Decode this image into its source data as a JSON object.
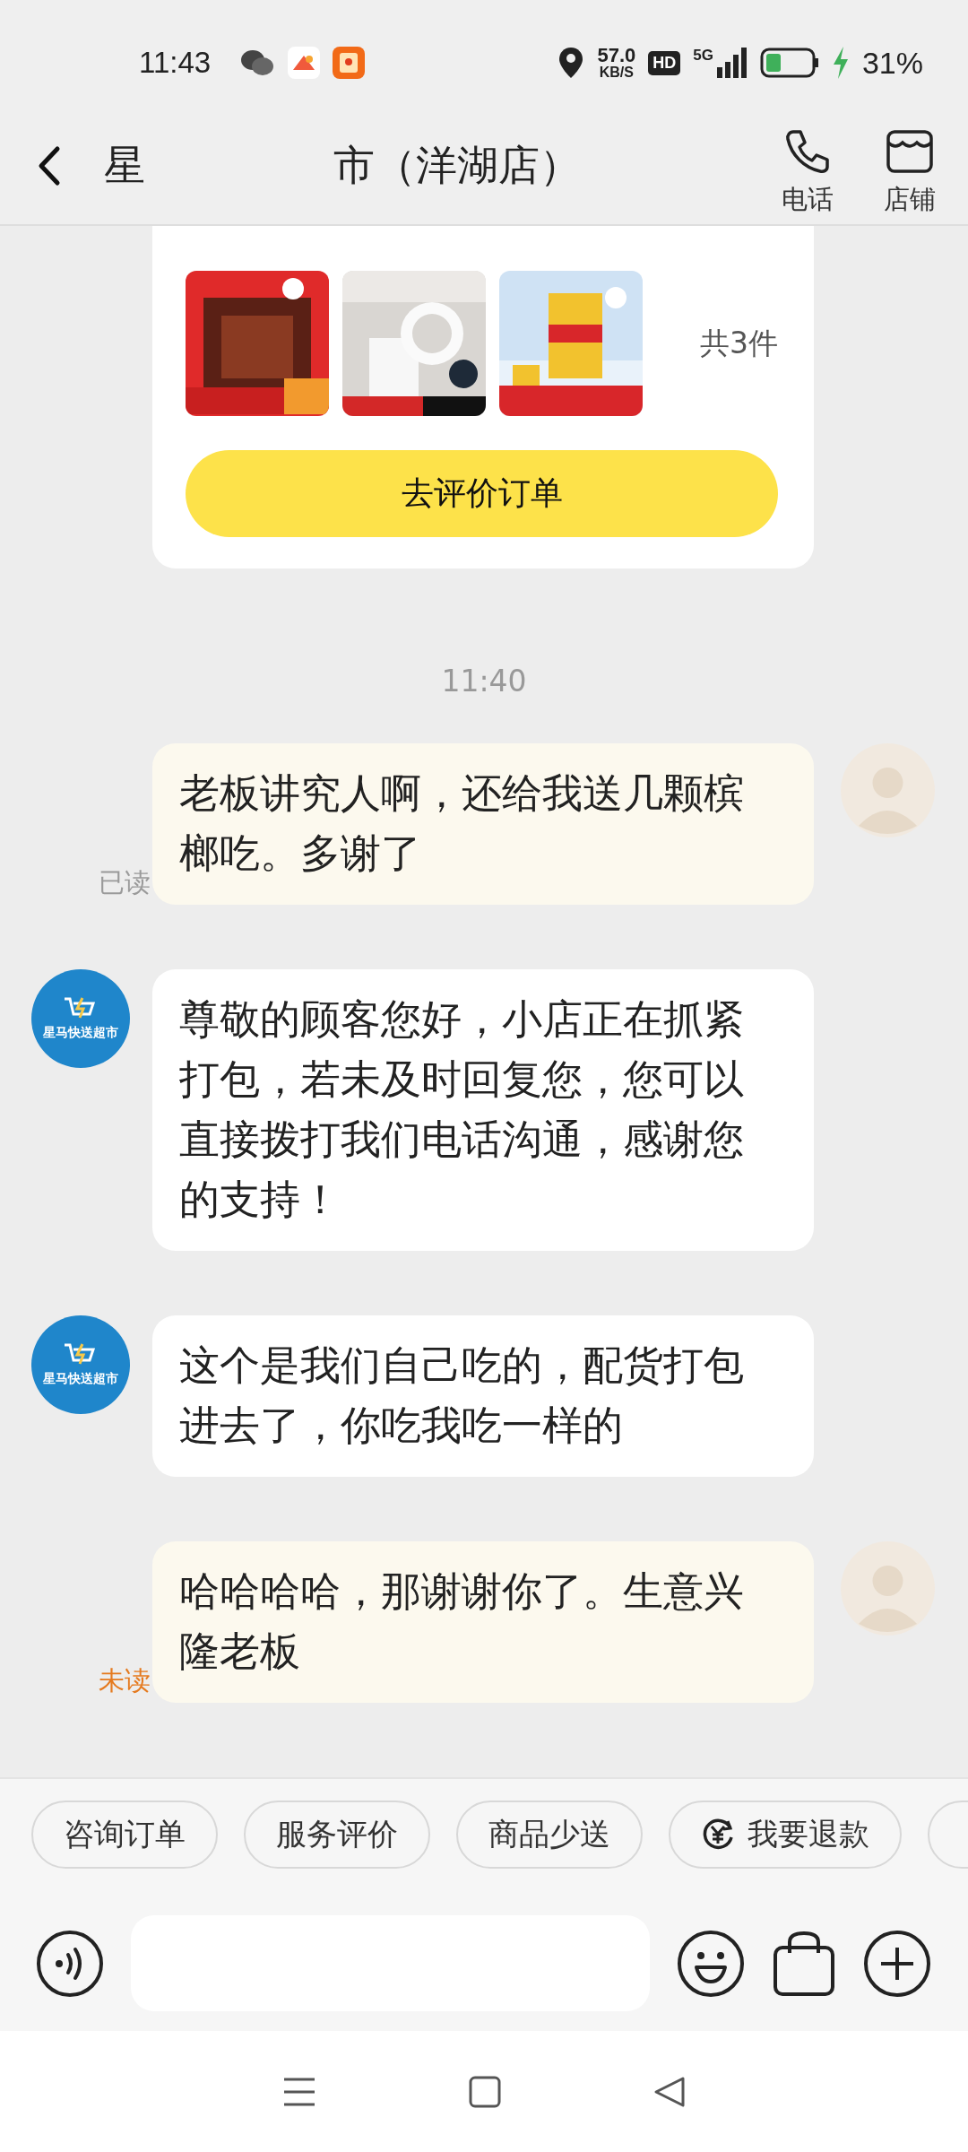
{
  "status_bar": {
    "time": "11:43",
    "speed_value": "57.0",
    "speed_unit": "KB/S",
    "hd": "HD",
    "network": "5G",
    "battery": "31%"
  },
  "header": {
    "title_start": "星",
    "title_end": "市（洋湖店）",
    "actions": [
      {
        "kind": "phone",
        "label": "电话"
      },
      {
        "kind": "store",
        "label": "店铺"
      }
    ]
  },
  "order_card": {
    "count": "共3件",
    "button": "去评价订单"
  },
  "messages": [
    {
      "kind": "time",
      "text": "11:40"
    },
    {
      "kind": "outgoing",
      "text": "老板讲究人啊，还给我送几颗槟榔吃。多谢了",
      "status": "已读",
      "read": true
    },
    {
      "kind": "incoming",
      "text": "尊敬的顾客您好，小店正在抓紧打包，若未及时回复您，您可以直接拨打我们电话沟通，感谢您的支持！",
      "avatar_label": "星马快送超市"
    },
    {
      "kind": "incoming",
      "text": "这个是我们自己吃的，配货打包进去了，你吃我吃一样的",
      "avatar_label": "星马快送超市"
    },
    {
      "kind": "outgoing",
      "text": "哈哈哈哈，那谢谢你了。生意兴隆老板",
      "status": "未读",
      "read": false
    }
  ],
  "quick_replies": [
    {
      "kind": "plain",
      "label": "咨询订单"
    },
    {
      "kind": "plain",
      "label": "服务评价"
    },
    {
      "kind": "plain",
      "label": "商品少送"
    },
    {
      "kind": "refund",
      "label": "我要退款"
    },
    {
      "kind": "cut"
    }
  ],
  "input_bar": {
    "tools": [
      {
        "kind": "emoji"
      },
      {
        "kind": "bag"
      },
      {
        "kind": "plus"
      }
    ]
  }
}
